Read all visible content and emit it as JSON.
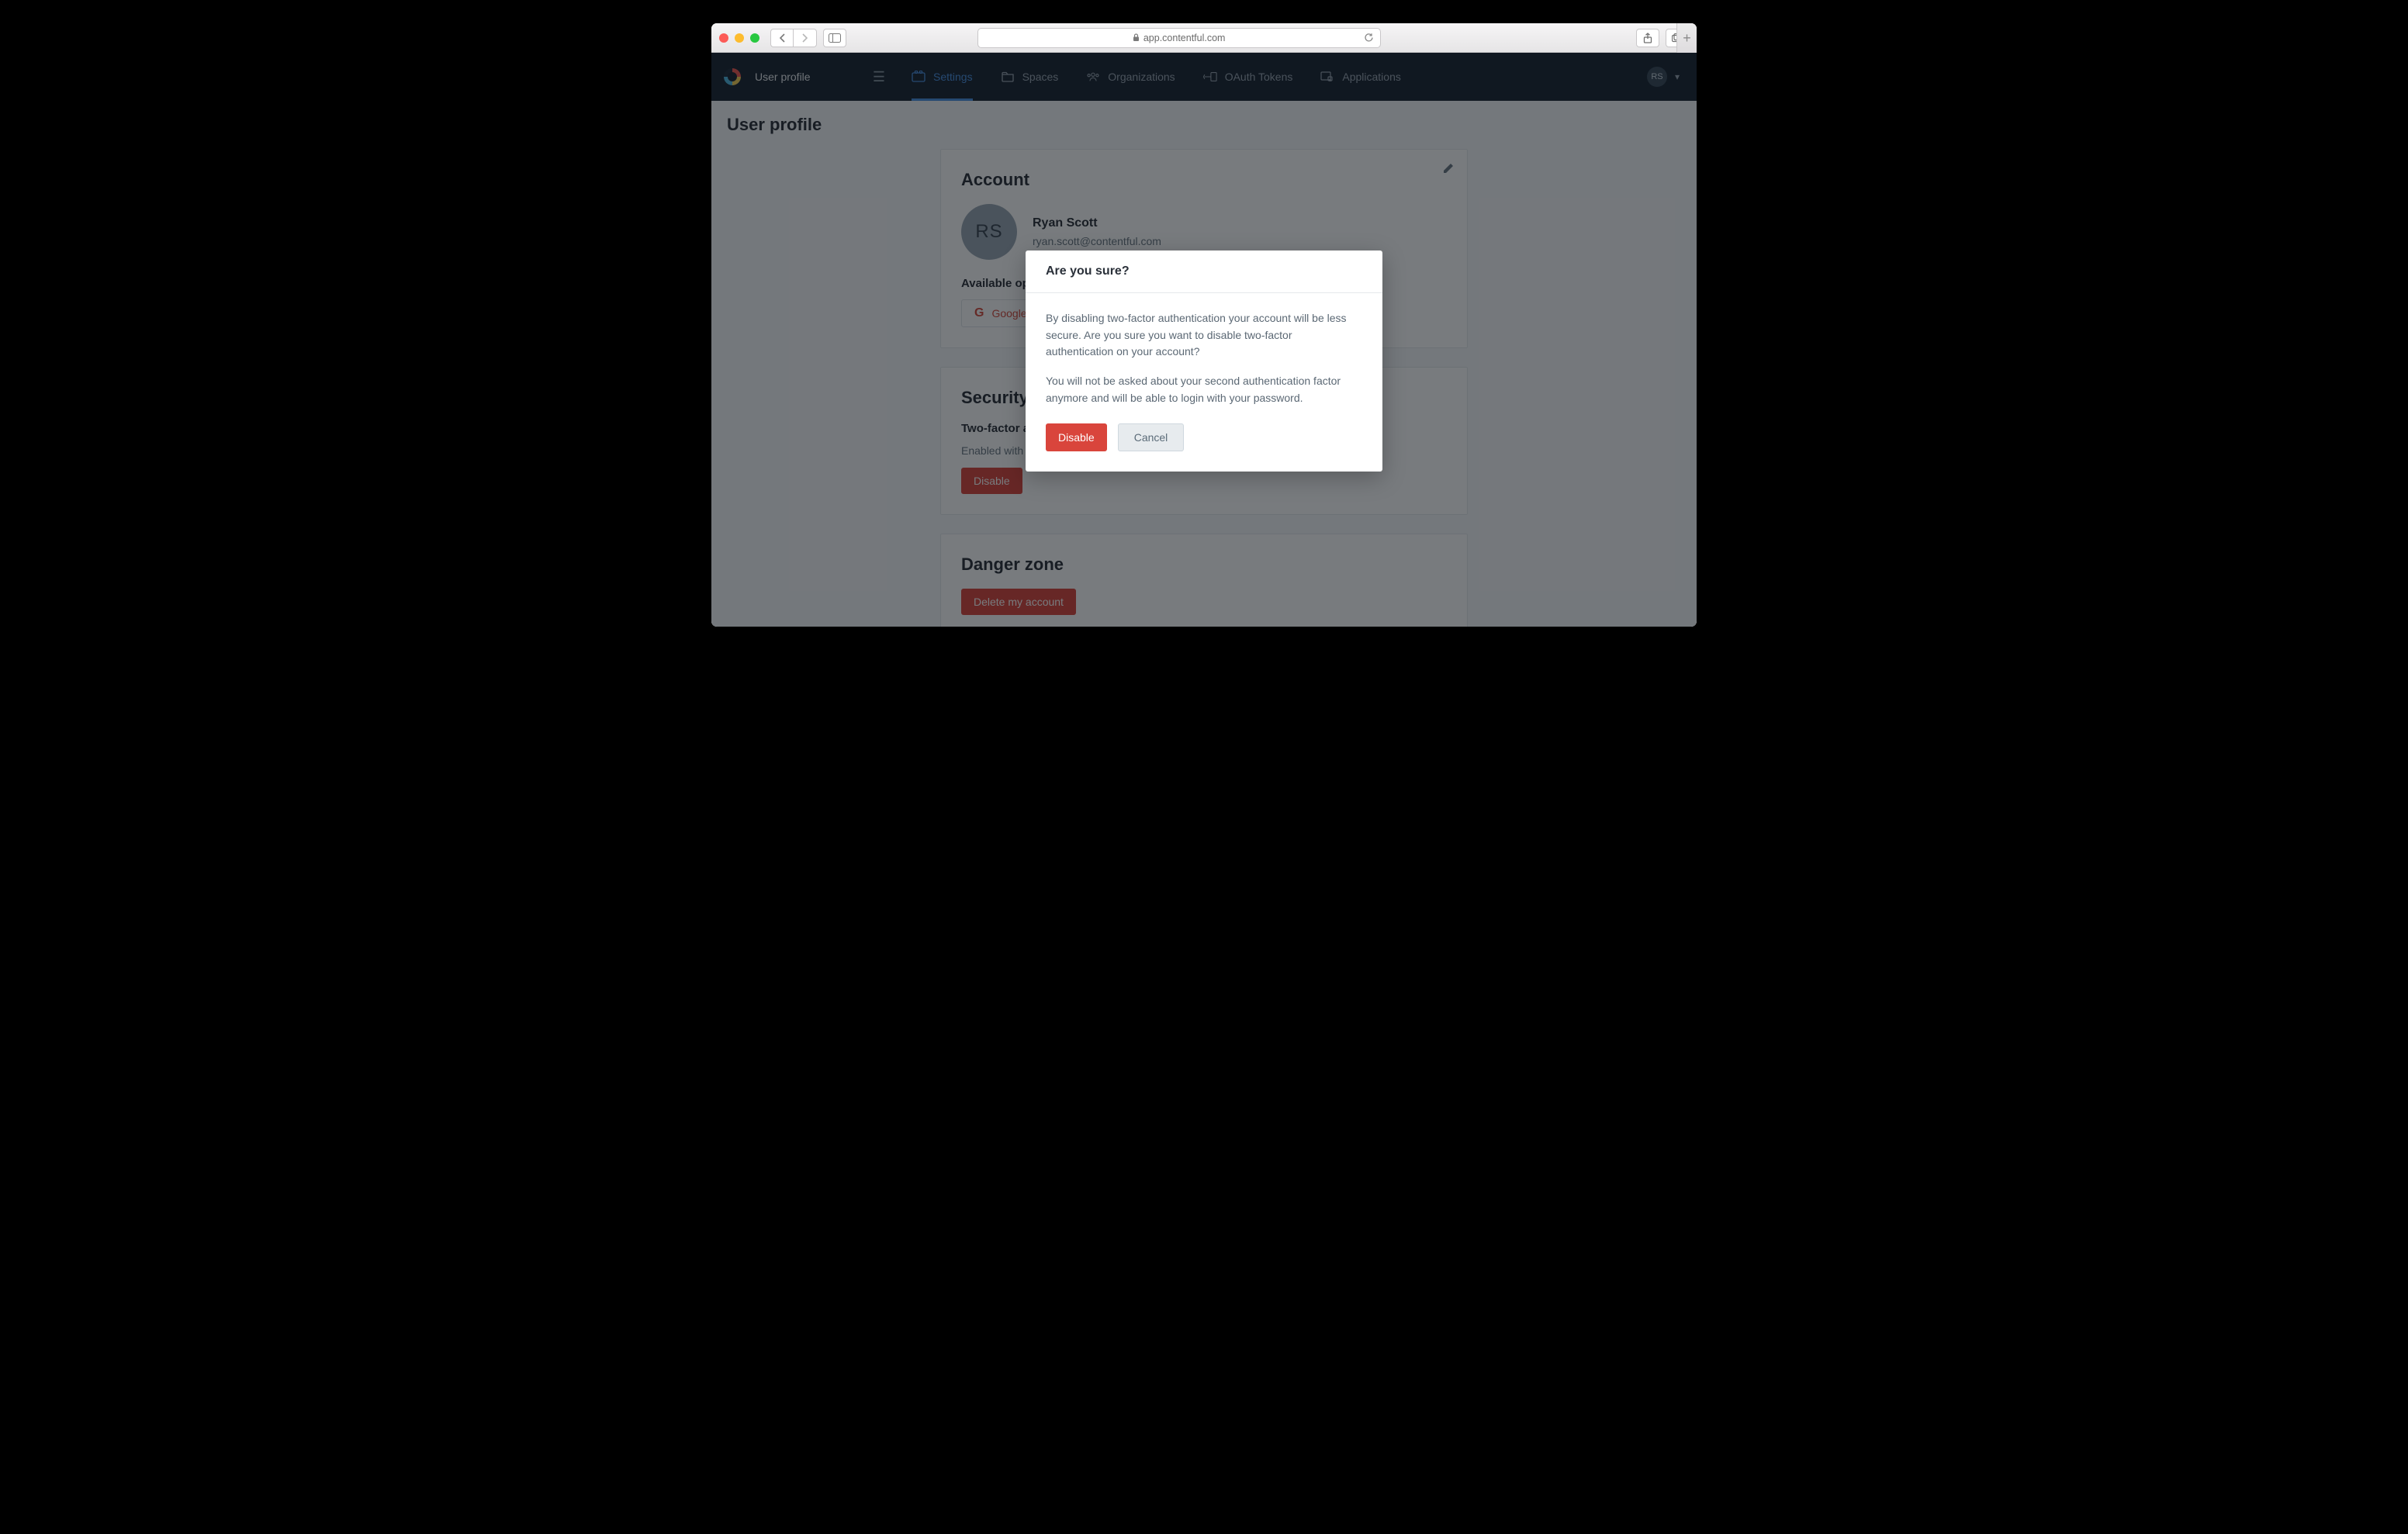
{
  "browser": {
    "url_display": "app.contentful.com"
  },
  "nav": {
    "brand_title": "User profile",
    "tabs": {
      "settings": "Settings",
      "spaces": "Spaces",
      "orgs": "Organizations",
      "oauth": "OAuth Tokens",
      "apps": "Applications"
    },
    "avatar_initials": "RS"
  },
  "page": {
    "title": "User profile"
  },
  "account": {
    "heading": "Account",
    "name": "Ryan Scott",
    "email": "ryan.scott@contentful.com",
    "avatar_initials": "RS",
    "connections_heading": "Available open ID connections",
    "google_label": "Google"
  },
  "security": {
    "heading": "Security",
    "subheading": "Two-factor authentication",
    "status": "Enabled with authenticator app",
    "disable_label": "Disable"
  },
  "danger": {
    "heading": "Danger zone",
    "delete_label": "Delete my account"
  },
  "modal": {
    "title": "Are you sure?",
    "para1": "By disabling two-factor authentication your account will be less secure. Are you sure you want to disable two-factor authentication on your account?",
    "para2": "You will not be asked about your second authentication factor anymore and will be able to login with your password.",
    "confirm_label": "Disable",
    "cancel_label": "Cancel"
  }
}
